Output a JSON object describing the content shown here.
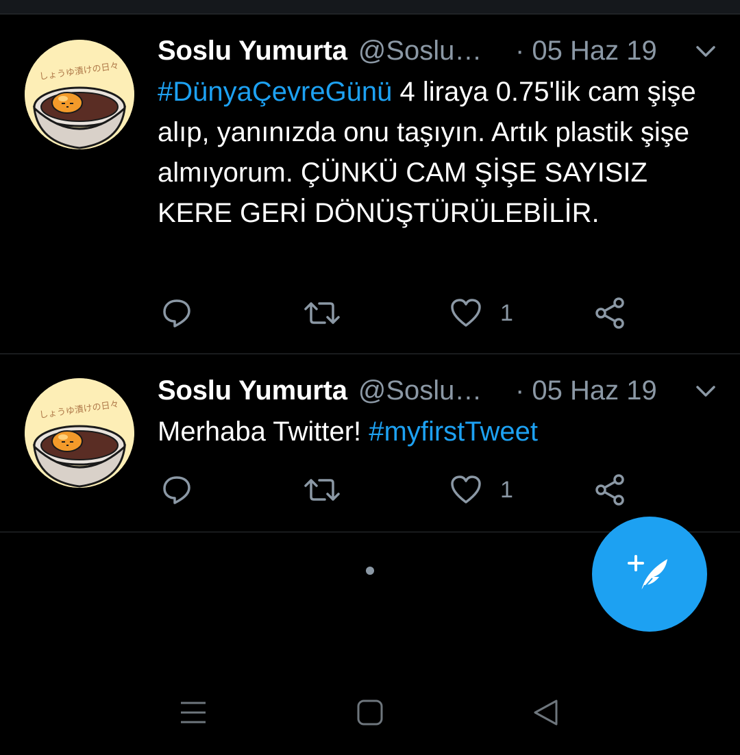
{
  "colors": {
    "background": "#000000",
    "accent": "#1da1f2",
    "secondary_text": "#8b98a5",
    "divider": "#2f3336"
  },
  "tweets": [
    {
      "author_name": "Soslu Yumurta",
      "handle": "@Soslu",
      "handle_ellipsis": "…",
      "date": "· 05 Haz 19",
      "body_hashtag": "#DünyaÇevreGünü",
      "body_text": " 4 liraya 0.75'lik cam şişe alıp, yanınızda onu taşıyın. Artık plastik şişe almıyorum. ÇÜNKÜ CAM ŞİŞE SAYISIZ KERE GERİ DÖNÜŞTÜRÜLEBİLİR.",
      "like_count": "1",
      "icons": [
        "reply-icon",
        "retweet-icon",
        "like-icon",
        "share-icon",
        "chevron-down-icon"
      ]
    },
    {
      "author_name": "Soslu Yumurta",
      "handle": "@Soslu",
      "handle_ellipsis": "…",
      "date": "· 05 Haz 19",
      "body_text": "Merhaba Twitter! ",
      "body_hashtag": "#myfirstTweet",
      "like_count": "1",
      "icons": [
        "reply-icon",
        "retweet-icon",
        "like-icon",
        "share-icon",
        "chevron-down-icon"
      ]
    }
  ],
  "avatar_text": "しょうゆ漬けの日々",
  "fab_icon": "compose-tweet-icon",
  "nav_icons": [
    "recent-apps-icon",
    "home-icon",
    "back-icon"
  ]
}
